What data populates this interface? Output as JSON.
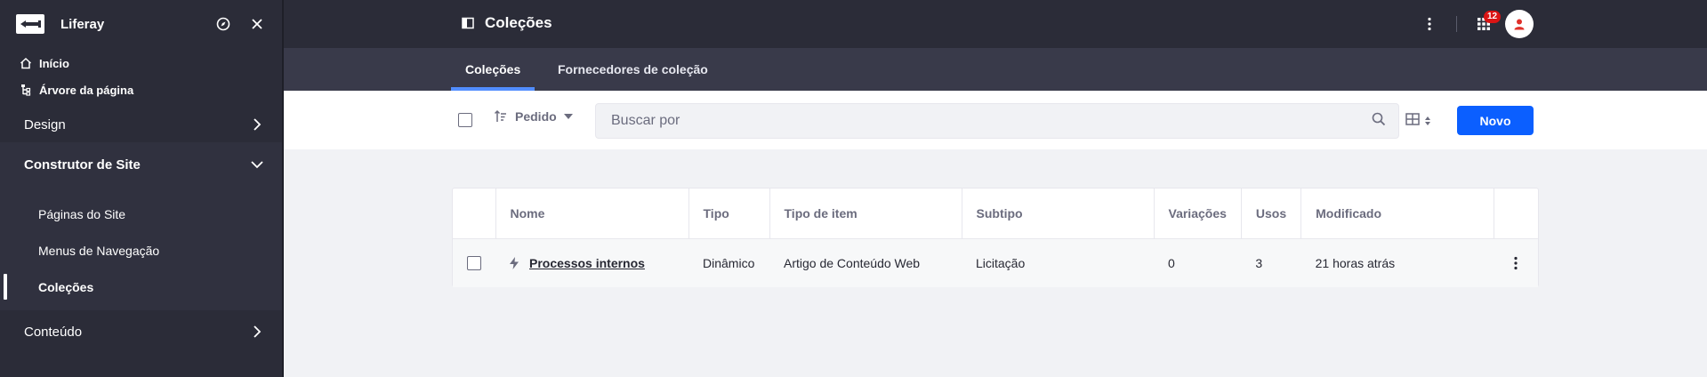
{
  "sidebar": {
    "brand": "Liferay",
    "quick": [
      {
        "label": "Início",
        "icon": "home-icon"
      },
      {
        "label": "Árvore da página",
        "icon": "page-tree-icon"
      }
    ],
    "categories": [
      {
        "label": "Design",
        "icon": "chevron-right-icon"
      },
      {
        "label": "Construtor de Site",
        "icon": "chevron-down-icon",
        "open": true
      },
      {
        "label": "Conteúdo",
        "icon": "chevron-right-icon"
      }
    ],
    "subitems": [
      "Páginas do Site",
      "Menus de Navegação",
      "Coleções"
    ],
    "active_subitem": "Coleções"
  },
  "topbar": {
    "title": "Coleções",
    "notifications_count": "12"
  },
  "tabs": [
    "Coleções",
    "Fornecedores de coleção"
  ],
  "toolbar": {
    "order_label": "Pedido",
    "search_placeholder": "Buscar por",
    "new_label": "Novo"
  },
  "table": {
    "columns": [
      "Nome",
      "Tipo",
      "Tipo de item",
      "Subtipo",
      "Variações",
      "Usos",
      "Modificado"
    ],
    "rows": [
      {
        "name": "Processos internos",
        "type": "Dinâmico",
        "item_type": "Artigo de Conteúdo Web",
        "subtype": "Licitação",
        "variations": "0",
        "uses": "3",
        "modified": "21 horas atrás"
      }
    ]
  },
  "colors": {
    "sidebar_bg": "#2b2c38",
    "tabs_bg": "#393a4a",
    "accent": "#0b5fff",
    "tab_indicator": "#528eff",
    "badge": "#da1414"
  }
}
